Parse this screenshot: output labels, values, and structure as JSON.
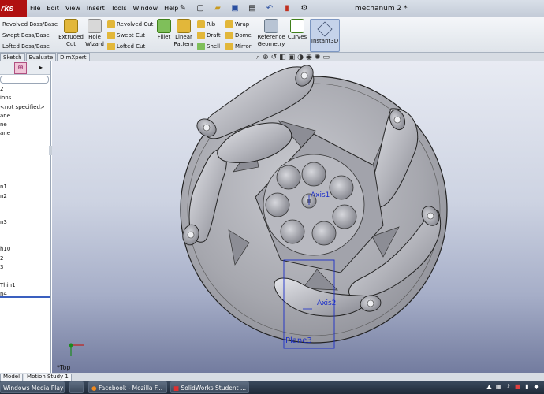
{
  "app": {
    "logo_text": "rks"
  },
  "menubar": {
    "items": [
      "File",
      "Edit",
      "View",
      "Insert",
      "Tools",
      "Window",
      "Help"
    ]
  },
  "quick_access": {
    "icons": [
      "pin-icon",
      "new-document-icon",
      "open-folder-icon",
      "save-icon",
      "print-icon",
      "undo-icon",
      "rebuild-icon",
      "options-icon"
    ]
  },
  "document": {
    "title": "mechanum 2 *"
  },
  "command_manager": {
    "left_stack": [
      "Revolved Boss/Base",
      "Swept Boss/Base",
      "Lofted Boss/Base"
    ],
    "extruded_cut": "Extruded\nCut",
    "hole_wizard": "Hole\nWizard",
    "cut_stack": [
      "Revolved Cut",
      "Swept Cut",
      "Lofted Cut"
    ],
    "fillet": "Fillet",
    "linear_pattern": "Linear\nPattern",
    "feature_stack_a": [
      "Rib",
      "Draft",
      "Shell"
    ],
    "feature_stack_b": [
      "Wrap",
      "Dome",
      "Mirror"
    ],
    "reference_geometry": "Reference\nGeometry",
    "curves": "Curves",
    "instant3d": "Instant3D"
  },
  "tabs": [
    "Sketch",
    "Evaluate",
    "DimXpert"
  ],
  "view_toolbar": {
    "icons": [
      "zoom-fit-icon",
      "zoom-area-icon",
      "previous-view-icon",
      "section-view-icon",
      "view-orientation-icon",
      "display-style-icon",
      "hide-show-icon",
      "appearance-icon",
      "scene-icon"
    ]
  },
  "feature_tree": {
    "items": [
      "2",
      "ions",
      "<not specified>",
      "ane",
      "ne",
      "ane",
      "",
      "",
      "",
      "",
      "",
      "n1",
      "n2",
      "",
      "",
      "n3",
      "",
      "",
      "h10",
      "2",
      "3",
      "",
      "Thin1",
      "n4"
    ]
  },
  "viewport": {
    "labels": {
      "axis1": "Axis1",
      "axis2": "Axis2",
      "plane3": "Plane3",
      "orientation": "*Top"
    }
  },
  "bottom_tabs": [
    "Model",
    "Motion Study 1"
  ],
  "taskbar": {
    "items": [
      "Windows Media Player",
      "",
      "Facebook - Mozilla F...",
      "SolidWorks Student ..."
    ]
  },
  "colors": {
    "accent": "#3a5fbf",
    "logo": "#b01010",
    "part": "#a9aab0",
    "annotation": "#1b2ec9"
  }
}
